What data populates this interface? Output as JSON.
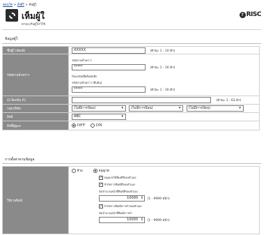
{
  "breadcrumb": {
    "home": "ตอนโค",
    "sep1": " > ",
    "mid": "ตั้งผี่ใ",
    "sep2": " > ",
    "current": "ห้นผู้ใ"
  },
  "header": {
    "title": "เห็มผู้ใ",
    "subtitle": "ตามเบร์นผู้ใหว้ใช้",
    "help_label": "RISC",
    "help_icon": "help-icon"
  },
  "section_user": "ข้อมูลผู้ใ",
  "rows": {
    "user_name": {
      "label": "ชื่อผู้ใ (ต้องมี)",
      "value": "XXXXX",
      "hint": "(ตัวนะ 1 - 10 ตัว)"
    },
    "password": {
      "label": "รหัสผ่านชั่วคราว",
      "caption1": "รหัสผ่านชั่วคราว",
      "value1": "*****",
      "hint1": "(ตัวนะ 1 - 16 ตัว)",
      "caption2": "ป้อนรหัสเพื่อยืนยันอีก",
      "caption3": "รหัสผ่านชั่วคราว (ยืนยัน)",
      "value2": "*****",
      "hint2": "(ตัวนะ 1 - 16 ตัว)"
    },
    "pc_id": {
      "label": "ID ล็อกอิน PC",
      "value": "",
      "hint": "(ตัวนะ 1 - 63 ตัว)"
    },
    "group": {
      "label": "กลุ่มบริษัท",
      "sel1": "(ไม่มีการป้อน)",
      "sel2": "(ไม่มีการป้อน)",
      "sel3": "(ไม่มีการป้อน)"
    },
    "role": {
      "label": "สิทธิ",
      "value": "ABC"
    },
    "admin": {
      "label": "สิทธิ์ผู้ดูแล",
      "off": "OFF",
      "on": "ON"
    }
  },
  "section_limits": "การตั้งค่าตามข้อมูล",
  "limits": {
    "label": "ใช้งานพิมพ์",
    "radio_all": "ห้าม",
    "radio_limit": "อนุญาต",
    "chk1": "อนุญาตให้พิมพ์สีของตัวเอง",
    "chk2": "จำกัดการพิมพ์สีของตัวเอง",
    "cap1": "นับจำนวนหน้าที่พิมพ์สีของตัวเอง",
    "num1": "10000",
    "range1": "(1 - 9999 หน้า)",
    "chk3": "จำกัดการพิมพ์ขาวดำของตัวเอง",
    "cap2": "นับจำนวนหน้าที่พิมพ์ขาวดำ",
    "num2": "10000",
    "range2": "(1 - 9999 หน้า)"
  }
}
